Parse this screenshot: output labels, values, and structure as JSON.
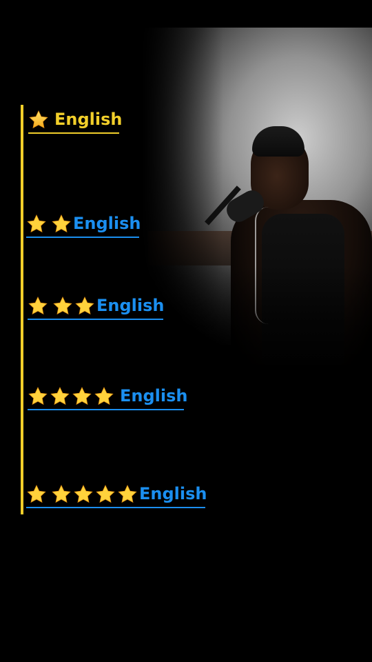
{
  "overlay": {
    "label_color_level1": "#f2cf2a",
    "label_color_other": "#1b8ff0",
    "rail_color": "#f2cf2a",
    "levels": [
      {
        "stars": 1,
        "label": "English"
      },
      {
        "stars": 2,
        "label": "English"
      },
      {
        "stars": 3,
        "label": "English"
      },
      {
        "stars": 4,
        "label": "English"
      },
      {
        "stars": 5,
        "label": "English"
      }
    ]
  },
  "icons": {
    "star": "star-icon"
  }
}
